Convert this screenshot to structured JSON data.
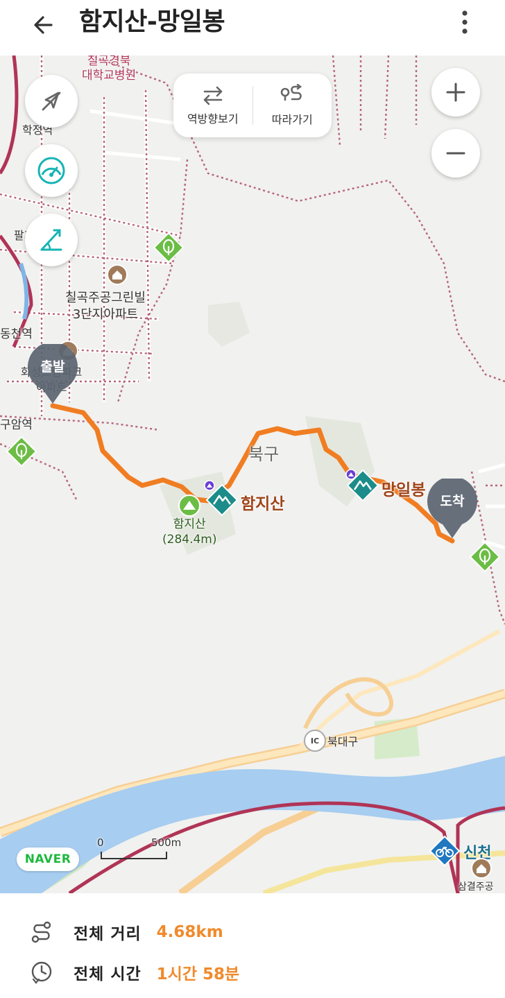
{
  "header": {
    "title": "함지산-망일봉"
  },
  "toolbar": {
    "reverse_label": "역방향보기",
    "follow_label": "따라가기"
  },
  "map": {
    "labels": {
      "hospital": "칠곡경북\n대학교병원",
      "apt1": "칠곡주공그린빌\n3단지아파트",
      "apt2": "화성드림파크\n아파트",
      "station1": "동천역",
      "station2": "학정역",
      "station3": "팔거역",
      "station4": "구암역",
      "district": "북구",
      "peak": "함지산\n(284.4m)",
      "poi1": "함지산",
      "poi2": "망일봉",
      "ic": "북대구",
      "ic_badge": "IC",
      "sinchon": "신천",
      "bottom_cut": "삼결주공"
    },
    "start_label": "출발",
    "end_label": "도착",
    "scale_zero": "0",
    "scale_label": "500m",
    "logo": "NAVER",
    "colors": {
      "route": "#f07d22",
      "marker": "#5a6470",
      "accent": "#16b4b4",
      "poi": "#1b8c8a",
      "green": "#6cbd45"
    }
  },
  "summary": {
    "distance_label": "전체 거리",
    "distance_value": "4.68km",
    "time_label": "전체 시간",
    "time_value": "1시간 58분"
  }
}
